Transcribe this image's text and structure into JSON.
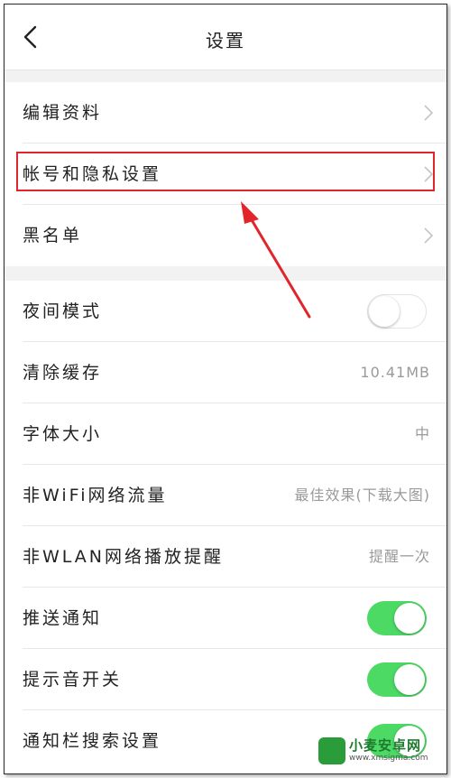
{
  "header": {
    "title": "设置",
    "back_icon": "chevron-left-icon"
  },
  "group1": [
    {
      "label": "编辑资料"
    },
    {
      "label": "帐号和隐私设置"
    },
    {
      "label": "黑名单"
    }
  ],
  "group2": [
    {
      "label": "夜间模式",
      "toggle": "off"
    },
    {
      "label": "清除缓存",
      "value": "10.41MB"
    },
    {
      "label": "字体大小",
      "value": "中"
    },
    {
      "label": "非WiFi网络流量",
      "value": "最佳效果(下载大图)"
    },
    {
      "label": "非WLAN网络播放提醒",
      "value": "提醒一次"
    },
    {
      "label": "推送通知",
      "toggle": "on"
    },
    {
      "label": "提示音开关",
      "toggle": "on"
    },
    {
      "label": "通知栏搜索设置",
      "toggle": "on"
    }
  ],
  "colors": {
    "accent_green": "#4cd964",
    "highlight_red": "#e0252b"
  },
  "watermark": {
    "name": "小麦安卓网",
    "url": "www.xmsigma.com"
  }
}
